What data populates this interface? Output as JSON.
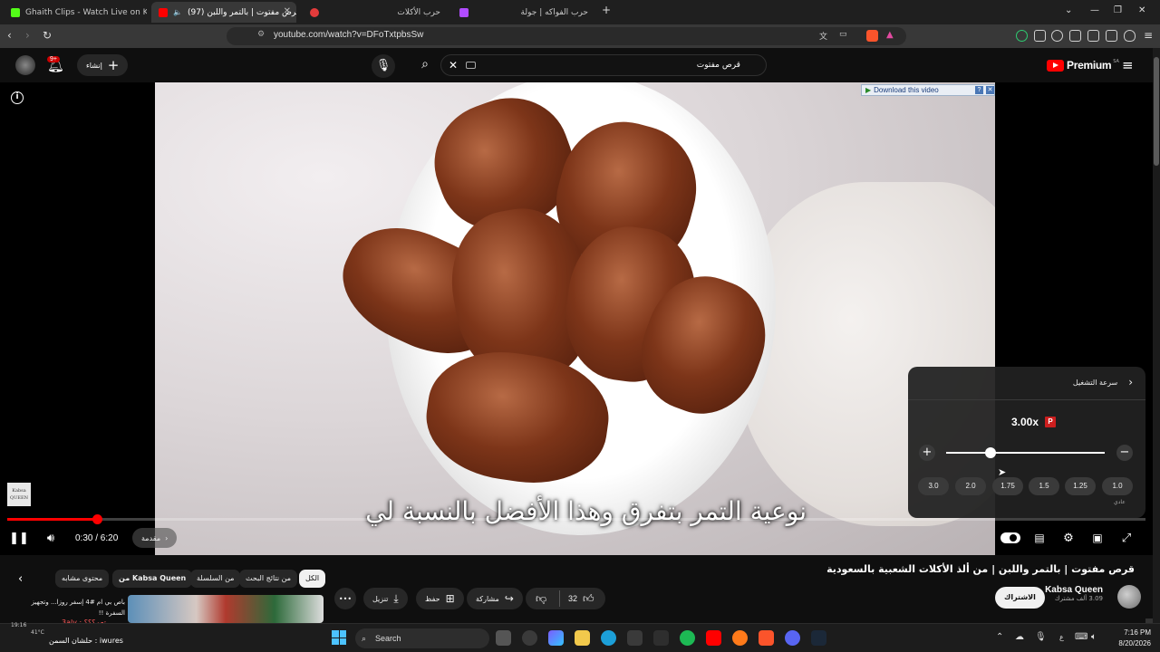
{
  "browser": {
    "tabs": [
      {
        "label": "Ghaith Clips - Watch Live on Kick",
        "color": "#53fc18"
      },
      {
        "label": "(97) قرص مفتوت | بالتمر واللبن",
        "color": "#ff0000"
      },
      {
        "label": "حرب الأكلات",
        "color": "#e33b3b"
      },
      {
        "label": "حرب الفواكه | جولة",
        "color": "#b14cff"
      }
    ],
    "new_tab": "+",
    "url": "youtube.com/watch?v=DFoTxtpbsSw"
  },
  "youtube": {
    "logo_word": "Premium",
    "logo_region": "SA",
    "search_value": "قرص مفتوت",
    "create_label": "إنشاء",
    "notif_count": "9+"
  },
  "player": {
    "download_bar": "Download this video",
    "subtitle": "نوعية التمر بتفرق وهذا الأفضل بالنسبة لي",
    "time": "0:30 / 6:20",
    "chapter": "مقدمة",
    "progress_fraction": 0.0789,
    "watermark": "Kabsa QUEEN"
  },
  "speed_panel": {
    "header": "سرعة التشغيل",
    "value": "3.00x",
    "badge": "P",
    "slider_fraction": 0.28,
    "plus": "+",
    "minus": "−",
    "presets": [
      "3.0",
      "2.0",
      "1.75",
      "1.5",
      "1.25",
      "1.0"
    ],
    "normal_note": "عادي"
  },
  "video_info": {
    "title": "قرص مفتوت | بالتمر واللبن | من ألذ الأكلات الشعبية بالسعودية",
    "channel": "Kabsa Queen",
    "subscribers": "3.09 ألف مشترك",
    "subscribe": "الاشتراك",
    "likes": "32",
    "share": "مشاركة",
    "save": "حفظ",
    "download": "تنزيل"
  },
  "chips": [
    "الكل",
    "من نتائج البحث",
    "من السلسلة",
    "من Kabsa Queen",
    "محتوى مشابه"
  ],
  "related": {
    "title": "باص بي ام #4 إسفر روزا... وتجهيز السفرة",
    "badge": "!!"
  },
  "chat": [
    {
      "text": "3aly : تعم؟؟؟",
      "color": "#ff5a5a"
    },
    {
      "text": "حلشان السمن : iwures",
      "color": "#fff"
    }
  ],
  "taskbar": {
    "search": "Search",
    "time": "7:16 PM",
    "date": "8/20/2026",
    "weather": "41°C",
    "small_time": "19:16"
  }
}
